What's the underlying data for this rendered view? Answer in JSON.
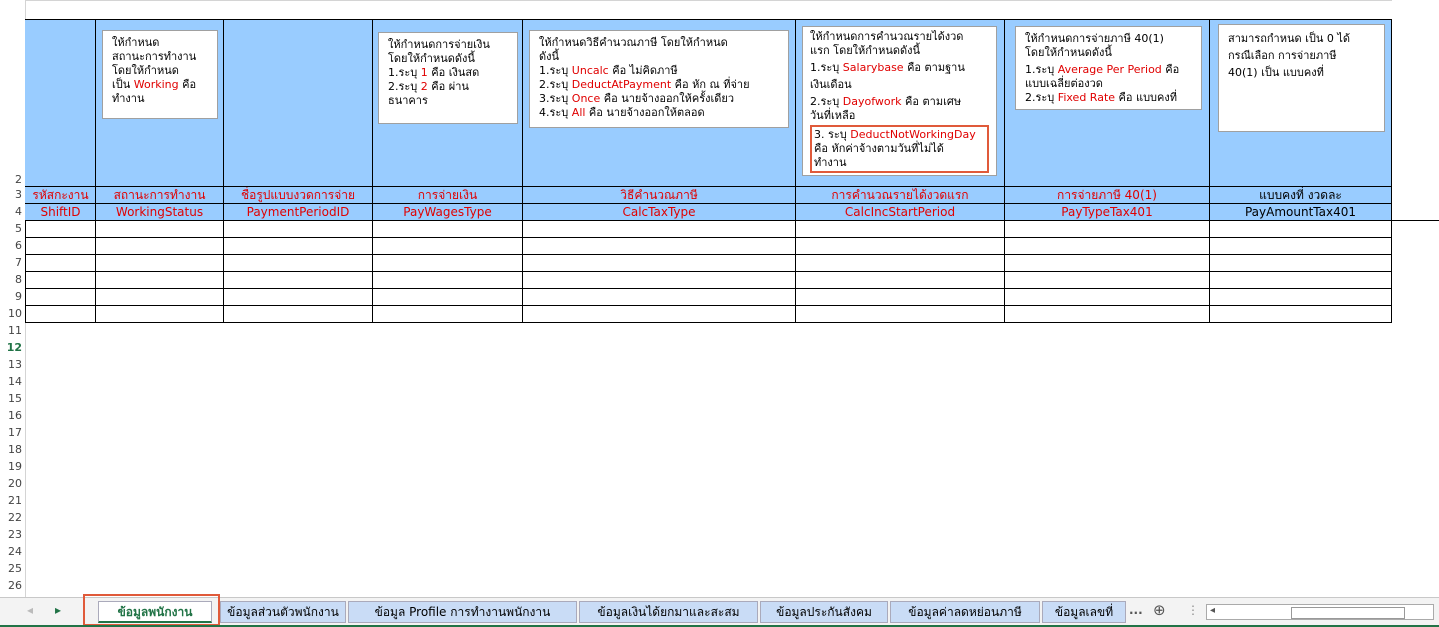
{
  "rows": [
    "2",
    "3",
    "4",
    "5",
    "6",
    "7",
    "8",
    "9",
    "10",
    "11",
    "12",
    "13",
    "14",
    "15",
    "16",
    "17",
    "18",
    "19",
    "20",
    "21",
    "22",
    "23",
    "24",
    "25",
    "26"
  ],
  "selected_row": "12",
  "columns": [
    {
      "label_th": "รหัสกะงาน",
      "field": "ShiftID"
    },
    {
      "label_th": "สถานะการทำงาน",
      "field": "WorkingStatus"
    },
    {
      "label_th": "ชื่อรูปแบบงวดการจ่าย",
      "field": "PaymentPeriodID"
    },
    {
      "label_th": "การจ่ายเงิน",
      "field": "PayWagesType"
    },
    {
      "label_th": "วิธีคำนวณภาษี",
      "field": "CalcTaxType"
    },
    {
      "label_th": "การคำนวณรายได้งวดแรก",
      "field": "CalcIncStartPeriod"
    },
    {
      "label_th": "การจ่ายภาษี 40(1)",
      "field": "PayTypeTax401"
    },
    {
      "label_th": "แบบคงที่ งวดละ",
      "field": "PayAmountTax401"
    }
  ],
  "notes": {
    "working_status": {
      "l1": "ให้กำหนด",
      "l2": "สถานะการทำงาน",
      "l3": "โดยให้กำหนด",
      "l4a": "เป็น ",
      "l4b": "Working",
      "l4c": " คือ",
      "l5": "ทำงาน"
    },
    "pay_wages": {
      "l1": "ให้กำหนดการจ่ายเงิน",
      "l2": "โดยให้กำหนดดังนี้",
      "l3a": "1.ระบุ ",
      "l3b": "1",
      "l3c": " คือ เงินสด",
      "l4a": "2.ระบุ ",
      "l4b": "2",
      "l4c": " คือ ผ่าน",
      "l5": "ธนาคาร"
    },
    "calc_tax": {
      "l1": "ให้กำหนดวิธีคำนวณภาษี   โดยให้กำหนด",
      "l2": "ดังนี้",
      "l3a": "1.ระบุ ",
      "l3b": "Uncalc",
      "l3c": "  คือ ไม่คิดภาษี",
      "l4a": "2.ระบุ ",
      "l4b": "DeductAtPayment",
      "l4c": " คือ หัก ณ ที่จ่าย",
      "l5a": "3.ระบุ ",
      "l5b": "Once",
      "l5c": " คือ นายจ้างออกให้ครั้งเดียว",
      "l6a": "4.ระบุ ",
      "l6b": "All",
      "l6c": " คือ นายจ้างออกให้ตลอด"
    },
    "calc_inc": {
      "l1": "ให้กำหนดการคำนวณรายได้งวด",
      "l2": "แรก  โดยให้กำหนดดังนี้",
      "l3a": "1.ระบุ ",
      "l3b": "Salarybase",
      "l3c": " คือ ตามฐาน",
      "l4": "เงินเดือน",
      "l5a": "2.ระบุ ",
      "l5b": "Dayofwork",
      "l5c": " คือ ตามเศษ",
      "l6": "วันที่เหลือ",
      "l7a": "3. ระบุ ",
      "l7b": "DeductNotWorkingDay",
      "l8": "คือ หักค่าจ้างตามวันที่ไม่ได้",
      "l9": "ทำงาน"
    },
    "pay_tax": {
      "l1": "ให้กำหนดการจ่ายภาษี 40(1)",
      "l2": "โดยให้กำหนดดังนี้",
      "l3a": "1.ระบุ ",
      "l3b": "Average Per Period",
      "l3c": " คือ",
      "l4": "แบบเฉลี่ยต่องวด",
      "l5a": "2.ระบุ ",
      "l5b": "Fixed Rate",
      "l5c": " คือ แบบคงที่"
    },
    "pay_amount": {
      "l1": "สามารถกำหนด เป็น 0 ได้",
      "l2": "กรณีเลือก การจ่ายภาษี",
      "l3": "40(1) เป็น แบบคงที่"
    }
  },
  "tabs": [
    {
      "label": "ข้อมูลพนักงาน",
      "active": true
    },
    {
      "label": "ข้อมูลส่วนตัวพนักงาน",
      "active": false
    },
    {
      "label": "ข้อมูล Profile การทำงานพนักงาน",
      "active": false
    },
    {
      "label": "ข้อมูลเงินได้ยกมาและสะสม",
      "active": false
    },
    {
      "label": "ข้อมูลประกันสังคม",
      "active": false
    },
    {
      "label": "ข้อมูลค่าลดหย่อนภาษี",
      "active": false
    },
    {
      "label": "ข้อมูลเลขที่",
      "active": false
    }
  ],
  "tabbar": {
    "ellipsis": "...",
    "add_icon": "plus-circle-icon",
    "more_icon": "vertical-dots-icon"
  },
  "colors": {
    "header_blue": "#99ccff",
    "red_text": "#e00000",
    "excel_green": "#217346",
    "highlight_box": "#e05a3a"
  }
}
